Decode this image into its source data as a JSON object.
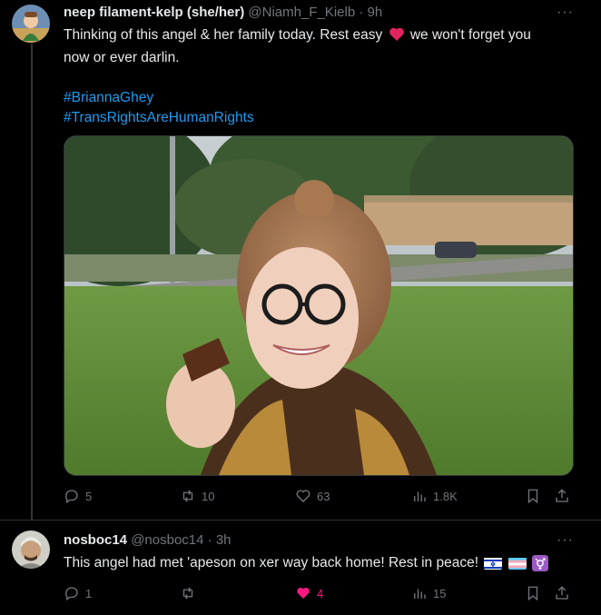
{
  "tweets": [
    {
      "display_name": "neep filament-kelp (she/her)",
      "handle": "@Niamh_F_Kielb",
      "separator": "·",
      "time": "9h",
      "more": "···",
      "text_line1": "Thinking of this angel & her family today. Rest easy",
      "text_line1_end": "we won't forget you",
      "text_line2": "now or ever darlin.",
      "hashtag1": "#BriannaGhey",
      "hashtag2": "#TransRightsAreHumanRights",
      "actions": {
        "replies": "5",
        "reposts": "10",
        "likes": "63",
        "views": "1.8K"
      }
    },
    {
      "display_name": "nosboc14",
      "handle": "@nosboc14",
      "separator": "·",
      "time": "3h",
      "more": "···",
      "text": "This angel had met 'apeson on xer way back home! Rest in peace!",
      "actions": {
        "replies": "1",
        "reposts": "",
        "likes": "4",
        "views": "15"
      }
    }
  ],
  "colors": {
    "background": "#000000",
    "text": "#e7e9ea",
    "muted": "#71767b",
    "link": "#1d9bf0",
    "like_active": "#f91880",
    "heart_emoji": "#e0245e"
  }
}
